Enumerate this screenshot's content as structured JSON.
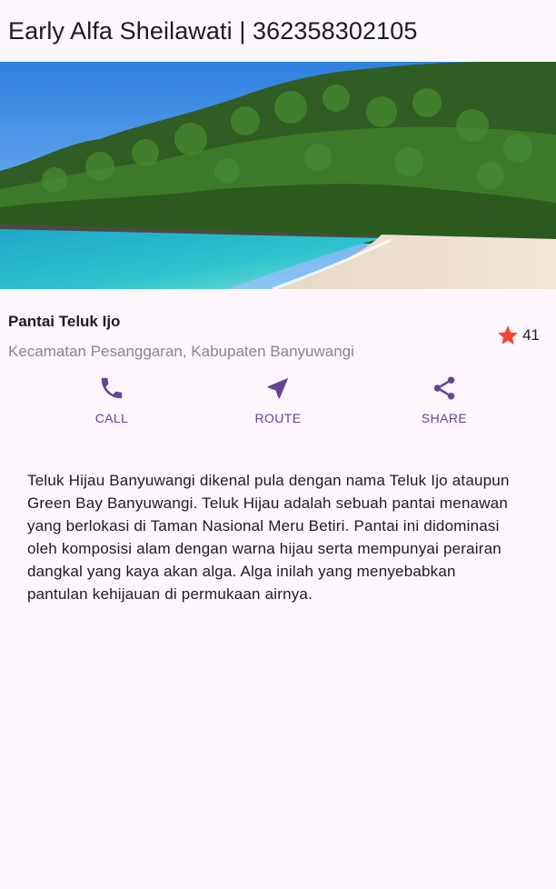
{
  "app_bar": {
    "title": "Early Alfa Sheilawati | 362358302105"
  },
  "place": {
    "name": "Pantai Teluk Ijo",
    "location": "Kecamatan Pesanggaran, Kabupaten Banyuwangi",
    "rating": "41"
  },
  "actions": {
    "call_label": "CALL",
    "route_label": "ROUTE",
    "share_label": "SHARE"
  },
  "description": "Teluk Hijau Banyuwangi dikenal pula dengan nama Teluk Ijo ataupun Green Bay Banyuwangi. Teluk Hijau adalah sebuah pantai menawan yang berlokasi di Taman Nasional Meru Betiri. Pantai ini didominasi oleh komposisi alam dengan warna hijau serta mempunyai perairan dangkal yang kaya akan alga. Alga inilah yang menyebabkan pantulan kehijauan di permukaan airnya.",
  "colors": {
    "background": "#fdf7fd",
    "accent": "#65439b",
    "star": "#f44336",
    "secondary_text": "#8a858c"
  }
}
